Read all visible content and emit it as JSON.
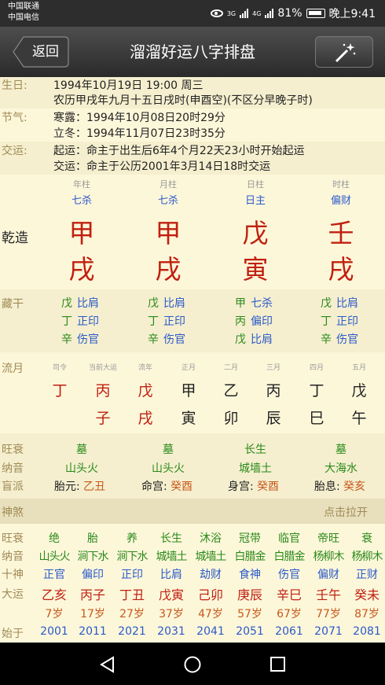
{
  "status": {
    "carrier1": "中国联通",
    "carrier2": "中国电信",
    "sig1": "3G",
    "sig2": "4G",
    "battery": "81%",
    "time": "晚上9:41"
  },
  "titlebar": {
    "back": "返回",
    "title": "溜溜好运八字排盘",
    "wand_icon": "magic-wand-icon"
  },
  "birth": {
    "label": "生日:",
    "line1": "1994年10月19日 19:00 周三",
    "line2": "农历甲戌年九月十五日戌时(申酉空)(不区分早晚子时)"
  },
  "jieqi": {
    "label": "节气:",
    "line1": "寒露：1994年10月08日20时29分",
    "line2": "立冬：1994年11月07日23时35分"
  },
  "jiaoyun": {
    "label": "交运:",
    "line1": "起运：命主于出生后6年4个月22天23小时开始起运",
    "line2": "交运：命主于公历2001年3月14日18时交运"
  },
  "chart": {
    "label": "乾造",
    "pillars": [
      {
        "name": "年柱",
        "shishen": "七杀",
        "gan": "甲",
        "zhi": "戌"
      },
      {
        "name": "月柱",
        "shishen": "七杀",
        "gan": "甲",
        "zhi": "戌"
      },
      {
        "name": "日柱",
        "shishen": "日主",
        "gan": "戊",
        "zhi": "寅"
      },
      {
        "name": "时柱",
        "shishen": "偏财",
        "gan": "壬",
        "zhi": "戌"
      }
    ]
  },
  "canggan": {
    "label": "藏干",
    "cols": [
      [
        [
          "戊",
          "比肩"
        ],
        [
          "丁",
          "正印"
        ],
        [
          "辛",
          "伤官"
        ]
      ],
      [
        [
          "戊",
          "比肩"
        ],
        [
          "丁",
          "正印"
        ],
        [
          "辛",
          "伤官"
        ]
      ],
      [
        [
          "甲",
          "七杀"
        ],
        [
          "丙",
          "偏印"
        ],
        [
          "戊",
          "比肩"
        ]
      ],
      [
        [
          "戊",
          "比肩"
        ],
        [
          "丁",
          "正印"
        ],
        [
          "辛",
          "伤官"
        ]
      ]
    ]
  },
  "liuyue": {
    "label": "流月",
    "heads": [
      "司令",
      "当前大运",
      "流年",
      "正月",
      "二月",
      "三月",
      "四月",
      "五月"
    ],
    "top": [
      "丁",
      "丙",
      "戊",
      "甲",
      "乙",
      "丙",
      "丁",
      "戊"
    ],
    "bottom": [
      "",
      "子",
      "戌",
      "寅",
      "卯",
      "辰",
      "巳",
      "午"
    ]
  },
  "wangshuai": {
    "label": "旺衰",
    "values": [
      "墓",
      "墓",
      "长生",
      "墓"
    ]
  },
  "nayin": {
    "label": "纳音",
    "values": [
      "山头火",
      "山头火",
      "城墙土",
      "大海水"
    ]
  },
  "mangpai": {
    "label": "盲派",
    "items": [
      {
        "k": "胎元:",
        "v": "乙丑"
      },
      {
        "k": "命宫:",
        "v": "癸酉"
      },
      {
        "k": "身宫:",
        "v": "癸酉"
      },
      {
        "k": "胎息:",
        "v": "癸亥"
      }
    ]
  },
  "shensha": {
    "label": "神煞",
    "action": "点击拉开"
  },
  "dayun": {
    "labels": {
      "ws": "旺衰",
      "ny": "纳音",
      "ss": "十神",
      "dy": "大运",
      "age": "",
      "start": "始于"
    },
    "ws": [
      "绝",
      "胎",
      "养",
      "长生",
      "沐浴",
      "冠带",
      "临官",
      "帝旺",
      "衰"
    ],
    "ny": [
      "山头火",
      "涧下水",
      "涧下水",
      "城墙土",
      "城墙土",
      "白腊金",
      "白腊金",
      "杨柳木",
      "杨柳木"
    ],
    "ss": [
      "正官",
      "偏印",
      "正印",
      "比肩",
      "劫财",
      "食神",
      "伤官",
      "偏财",
      "正财"
    ],
    "gz": [
      "乙亥",
      "丙子",
      "丁丑",
      "戊寅",
      "己卯",
      "庚辰",
      "辛巳",
      "壬午",
      "癸未"
    ],
    "age": [
      "7岁",
      "17岁",
      "27岁",
      "37岁",
      "47岁",
      "57岁",
      "67岁",
      "77岁",
      "87岁"
    ],
    "start": [
      "2001",
      "2011",
      "2021",
      "2031",
      "2041",
      "2051",
      "2061",
      "2071",
      "2081"
    ]
  }
}
